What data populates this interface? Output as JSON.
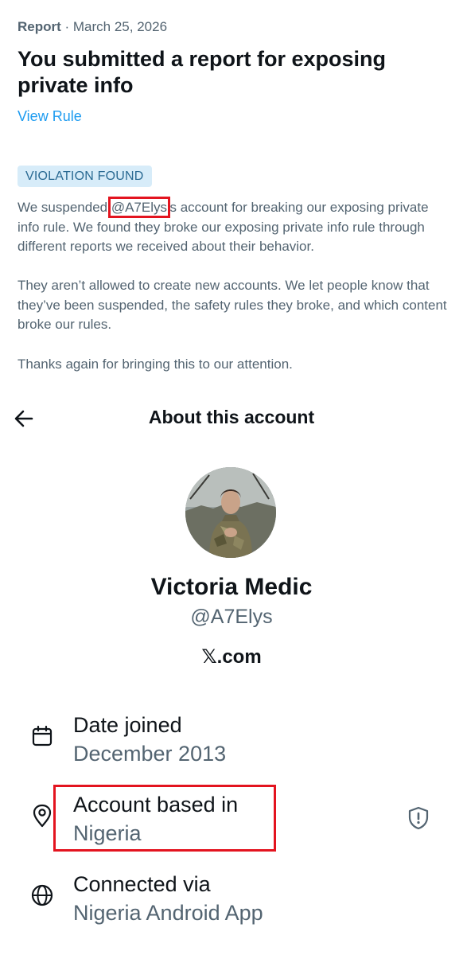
{
  "report": {
    "category": "Report",
    "separator": " · ",
    "date": "March 25, 2026",
    "title": "You submitted a report for exposing private info",
    "view_rule": "View Rule",
    "badge": "VIOLATION FOUND",
    "p1_before": "We suspended ",
    "p1_handle": "@A7Elys",
    "p1_after": "’s account for breaking our exposing private info rule. We found they broke our exposing private info rule through different reports we received about their behavior.",
    "p2": "They aren’t allowed to create new accounts. We let people know that they’ve been suspended, the safety rules they broke, and which content broke our rules.",
    "p3": "Thanks again for bringing this to our attention."
  },
  "about": {
    "header_title": "About this account",
    "name": "Victoria Medic",
    "handle": "@A7Elys",
    "site": "𝕏.com",
    "rows": [
      {
        "label": "Date joined",
        "value": "December 2013",
        "icon": "calendar-icon"
      },
      {
        "label": "Account based in",
        "value": "Nigeria",
        "icon": "location-pin-icon"
      },
      {
        "label": "Connected via",
        "value": "Nigeria Android App",
        "icon": "globe-icon"
      }
    ]
  },
  "icons": {
    "back": "arrow-left-icon",
    "shield": "shield-alert-icon"
  },
  "colors": {
    "link": "#1d9bf0",
    "badge_bg": "#d7ecf9",
    "badge_text": "#2a6a93",
    "highlight": "#e3141f",
    "secondary_text": "#536471"
  }
}
